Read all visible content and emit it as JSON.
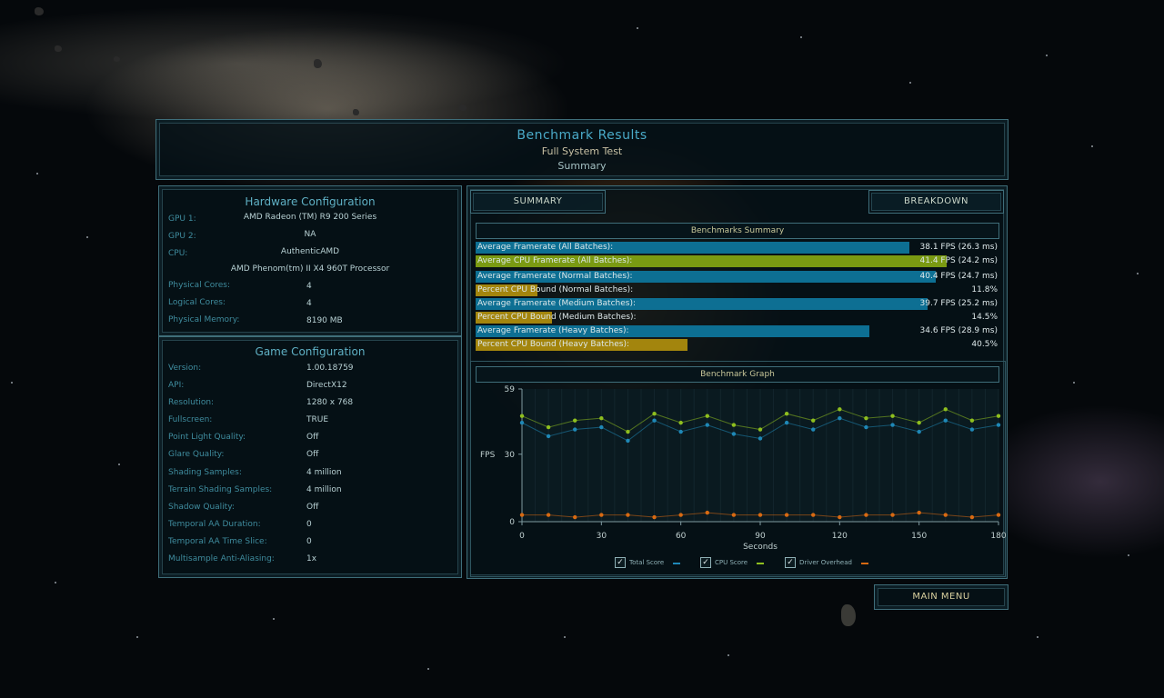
{
  "header": {
    "title": "Benchmark Results",
    "subtitle": "Full System Test",
    "page": "Summary"
  },
  "hardware": {
    "title": "Hardware Configuration",
    "gpu1_label": "GPU 1:",
    "gpu1_value": "AMD Radeon (TM) R9 200 Series",
    "gpu2_label": "GPU 2:",
    "gpu2_value": "NA",
    "cpu_label": "CPU:",
    "cpu_vendor": "AuthenticAMD",
    "cpu_model": "AMD Phenom(tm) II X4 960T Processor",
    "physical_cores_label": "Physical Cores:",
    "physical_cores_value": "4",
    "logical_cores_label": "Logical Cores:",
    "logical_cores_value": "4",
    "memory_label": "Physical Memory:",
    "memory_value": "8190  MB"
  },
  "game": {
    "title": "Game Configuration",
    "rows": [
      {
        "label": "Version:",
        "value": "1.00.18759"
      },
      {
        "label": "API:",
        "value": "DirectX12"
      },
      {
        "label": "Resolution:",
        "value": "1280 x 768"
      },
      {
        "label": "Fullscreen:",
        "value": "TRUE"
      },
      {
        "label": "Point Light Quality:",
        "value": "Off"
      },
      {
        "label": "Glare Quality:",
        "value": "Off"
      },
      {
        "label": "Shading Samples:",
        "value": "4 million"
      },
      {
        "label": "Terrain Shading Samples:",
        "value": "4 million"
      },
      {
        "label": "Shadow Quality:",
        "value": "Off"
      },
      {
        "label": "Temporal AA Duration:",
        "value": "0"
      },
      {
        "label": "Temporal AA Time Slice:",
        "value": "0"
      },
      {
        "label": "Multisample Anti-Aliasing:",
        "value": "1x"
      }
    ]
  },
  "tabs": {
    "summary": "SUMMARY",
    "breakdown": "BREAKDOWN"
  },
  "summary": {
    "title": "Benchmarks Summary",
    "rows": [
      {
        "label": "Average Framerate (All Batches):",
        "value": "38.1 FPS (26.3 ms)",
        "fill": 0.828,
        "color": "#0d6f93"
      },
      {
        "label": "Average CPU Framerate (All Batches):",
        "value": "41.4 FPS (24.2 ms)",
        "fill": 0.9,
        "color": "#7a9a12"
      },
      {
        "label": "Average Framerate (Normal Batches):",
        "value": "40.4 FPS (24.7 ms)",
        "fill": 0.878,
        "color": "#0d6f93"
      },
      {
        "label": "Percent CPU Bound (Normal Batches):",
        "value": "11.8%",
        "fill": 0.118,
        "color": "#a3850d"
      },
      {
        "label": "Average Framerate (Medium Batches):",
        "value": "39.7 FPS (25.2 ms)",
        "fill": 0.863,
        "color": "#0d6f93"
      },
      {
        "label": "Percent CPU Bound (Medium Batches):",
        "value": "14.5%",
        "fill": 0.145,
        "color": "#a3850d"
      },
      {
        "label": "Average Framerate (Heavy Batches):",
        "value": "34.6 FPS (28.9 ms)",
        "fill": 0.752,
        "color": "#0d6f93"
      },
      {
        "label": "Percent CPU Bound (Heavy Batches):",
        "value": "40.5%",
        "fill": 0.405,
        "color": "#a3850d"
      }
    ]
  },
  "graph": {
    "title": "Benchmark Graph",
    "legend": [
      {
        "label": "Total Score",
        "color": "#1f88b7",
        "checked": true
      },
      {
        "label": "CPU Score",
        "color": "#8fbf1f",
        "checked": true
      },
      {
        "label": "Driver Overhead",
        "color": "#d86a12",
        "checked": true
      }
    ]
  },
  "chart_data": {
    "type": "scatter",
    "title": "Benchmark Graph",
    "xlabel": "Seconds",
    "ylabel": "FPS",
    "xlim": [
      0,
      180
    ],
    "ylim": [
      0,
      59
    ],
    "xticks": [
      0,
      30,
      60,
      90,
      120,
      150,
      180
    ],
    "yticks": [
      0,
      30,
      59
    ],
    "series": [
      {
        "name": "Total Score",
        "color": "#1f88b7",
        "x": [
          0,
          10,
          20,
          30,
          40,
          50,
          60,
          70,
          80,
          90,
          100,
          110,
          120,
          130,
          140,
          150,
          160,
          170,
          180
        ],
        "y": [
          44,
          38,
          41,
          42,
          36,
          45,
          40,
          43,
          39,
          37,
          44,
          41,
          46,
          42,
          43,
          40,
          45,
          41,
          43
        ]
      },
      {
        "name": "CPU Score",
        "color": "#8fbf1f",
        "x": [
          0,
          10,
          20,
          30,
          40,
          50,
          60,
          70,
          80,
          90,
          100,
          110,
          120,
          130,
          140,
          150,
          160,
          170,
          180
        ],
        "y": [
          47,
          42,
          45,
          46,
          40,
          48,
          44,
          47,
          43,
          41,
          48,
          45,
          50,
          46,
          47,
          44,
          50,
          45,
          47
        ]
      },
      {
        "name": "Driver Overhead",
        "color": "#d86a12",
        "x": [
          0,
          10,
          20,
          30,
          40,
          50,
          60,
          70,
          80,
          90,
          100,
          110,
          120,
          130,
          140,
          150,
          160,
          170,
          180
        ],
        "y": [
          3,
          3,
          2,
          3,
          3,
          2,
          3,
          4,
          3,
          3,
          3,
          3,
          2,
          3,
          3,
          4,
          3,
          2,
          3
        ]
      }
    ]
  },
  "main_menu": "MAIN MENU"
}
